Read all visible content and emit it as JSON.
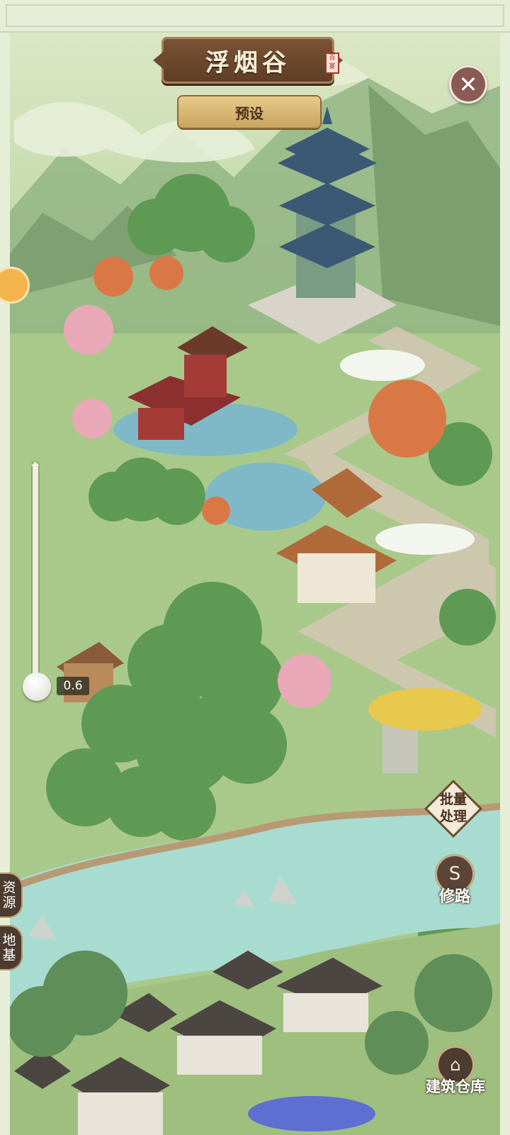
{
  "header": {
    "title": "浮烟谷",
    "seal_text": "百宴",
    "preset_label": "预设",
    "close_icon": "close-icon"
  },
  "zoom": {
    "plus_symbol": "+",
    "value_label": "0.6",
    "level": 0.06
  },
  "left_tabs": {
    "resources": "资源",
    "foundation": "地基"
  },
  "right_actions": {
    "batch": "批量处理",
    "road": "修路",
    "road_icon": "road-icon",
    "warehouse": "建筑仓库",
    "warehouse_icon": "warehouse-icon"
  },
  "colors": {
    "plaque_brown": "#6b4a2d",
    "preset_gold": "#d7b46f",
    "river": "#9fd3c8",
    "grass": "#a8c98a"
  }
}
